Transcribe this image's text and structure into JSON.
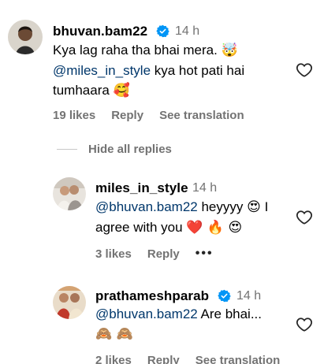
{
  "comments": [
    {
      "username": "bhuvan.bam22",
      "verified": true,
      "time": "14 h",
      "line1": "Kya lag raha tha bhai mera.",
      "line1_emoji": "🤯",
      "mention": "@miles_in_style",
      "line2_rest": " kya hot pati hai",
      "line3": "tumhaara",
      "line3_emoji": "🥰",
      "likes": "19 likes",
      "reply": "Reply",
      "translate": "See translation"
    },
    {
      "username": "miles_in_style",
      "verified": false,
      "time": "14 h",
      "mention": "@bhuvan.bam22",
      "line1_rest": " heyyyy",
      "line1_emoji": "😍",
      "line1_tail": " I",
      "line2": "agree with you",
      "line2_emojis": "❤️ 🔥 😍",
      "likes": "3 likes",
      "reply": "Reply",
      "more": "•••"
    },
    {
      "username": "prathameshparab",
      "verified": true,
      "time": "14 h",
      "mention": "@bhuvan.bam22",
      "line1_rest": " Are bhai...",
      "line2_emojis": "🙈 🙈",
      "likes": "2 likes",
      "reply": "Reply",
      "translate": "See translation"
    }
  ],
  "hide_replies": "Hide all replies",
  "colors": {
    "mention": "#00376b",
    "secondary": "#737373",
    "verified": "#0095f6"
  },
  "icons": {
    "like": "heart-outline-icon",
    "verified": "verified-badge-icon",
    "more": "more-options-icon"
  }
}
